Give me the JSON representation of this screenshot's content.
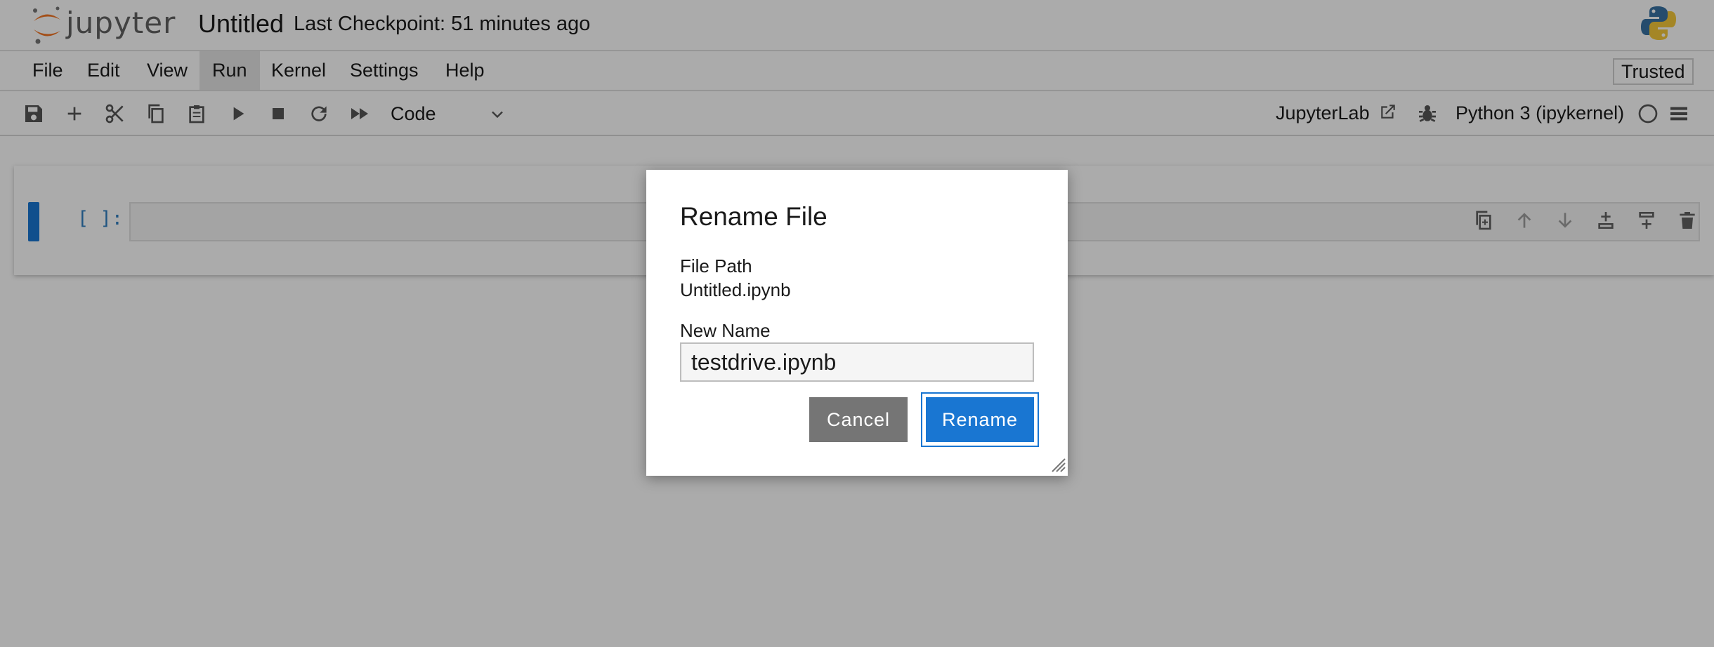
{
  "app": {
    "logo_text": "jupyter",
    "notebook_title": "Untitled",
    "checkpoint": "Last Checkpoint: 51 minutes ago"
  },
  "menu": {
    "items": [
      "File",
      "Edit",
      "View",
      "Run",
      "Kernel",
      "Settings",
      "Help"
    ],
    "active": "Run",
    "trusted_label": "Trusted"
  },
  "toolbar": {
    "icons": [
      "save-icon",
      "add-cell-icon",
      "cut-icon",
      "copy-icon",
      "paste-icon",
      "run-icon",
      "stop-icon",
      "restart-icon",
      "fast-forward-icon"
    ],
    "cell_type": "Code",
    "jupyterlab_label": "JupyterLab",
    "kernel_name": "Python 3 (ipykernel)"
  },
  "cell": {
    "prompt": "[ ]:",
    "tools": [
      "duplicate-icon",
      "move-up-icon",
      "move-down-icon",
      "insert-below-icon",
      "insert-above-icon",
      "delete-icon"
    ]
  },
  "dialog": {
    "title": "Rename File",
    "file_path_label": "File Path",
    "file_path_value": "Untitled.ipynb",
    "new_name_label": "New Name",
    "new_name_value": "testdrive.ipynb",
    "cancel_label": "Cancel",
    "rename_label": "Rename"
  },
  "colors": {
    "accent": "#1976d2",
    "logo_orange": "#f37726",
    "cancel_gray": "#757575",
    "overlay": "rgba(0,0,0,0.33)"
  }
}
